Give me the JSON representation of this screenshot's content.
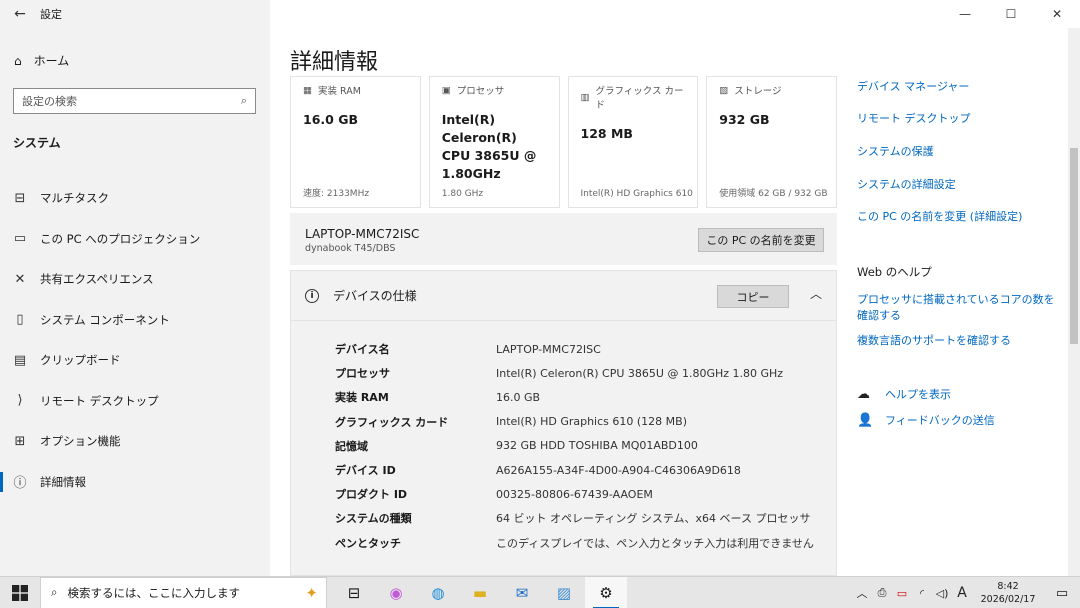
{
  "window": {
    "title": "設定",
    "controls": {
      "minimize": "—",
      "maximize": "☐",
      "close": "✕"
    }
  },
  "sidebar": {
    "home_label": "ホーム",
    "search_placeholder": "設定の検索",
    "section_title": "システム",
    "items": [
      {
        "label": "マルチタスク",
        "icon": "multitask-icon"
      },
      {
        "label": "この PC へのプロジェクション",
        "icon": "projection-icon"
      },
      {
        "label": "共有エクスペリエンス",
        "icon": "shared-experience-icon"
      },
      {
        "label": "システム コンポーネント",
        "icon": "system-components-icon"
      },
      {
        "label": "クリップボード",
        "icon": "clipboard-icon"
      },
      {
        "label": "リモート デスクトップ",
        "icon": "remote-desktop-icon"
      },
      {
        "label": "オプション機能",
        "icon": "optional-features-icon"
      },
      {
        "label": "詳細情報",
        "icon": "about-icon",
        "active": true
      }
    ]
  },
  "main": {
    "page_title": "詳細情報",
    "cards": [
      {
        "label": "実装 RAM",
        "value": "16.0 GB",
        "footer": "速度: 2133MHz",
        "icon": "ram-icon"
      },
      {
        "label": "プロセッサ",
        "value": "Intel(R) Celeron(R) CPU 3865U @ 1.80GHz",
        "footer": "1.80 GHz",
        "icon": "processor-icon"
      },
      {
        "label": "グラフィックス カード",
        "value": "128 MB",
        "footer": "Intel(R) HD Graphics 610",
        "icon": "graphics-icon"
      },
      {
        "label": "ストレージ",
        "value": "932 GB",
        "footer": "使用領域 62 GB / 932 GB",
        "icon": "storage-icon"
      }
    ],
    "device": {
      "name": "LAPTOP-MMC72ISC",
      "model": "dynabook T45/DBS",
      "rename_button": "この PC の名前を変更"
    },
    "specs": {
      "title": "デバイスの仕様",
      "copy_button": "コピー",
      "rows": [
        {
          "key": "デバイス名",
          "value": "LAPTOP-MMC72ISC"
        },
        {
          "key": "プロセッサ",
          "value": "Intel(R) Celeron(R) CPU 3865U @ 1.80GHz   1.80 GHz"
        },
        {
          "key": "実装 RAM",
          "value": "16.0 GB"
        },
        {
          "key": "グラフィックス カード",
          "value": "Intel(R) HD Graphics 610 (128 MB)"
        },
        {
          "key": "記憶域",
          "value": "932 GB HDD TOSHIBA MQ01ABD100"
        },
        {
          "key": "デバイス ID",
          "value": "A626A155-A34F-4D00-A904-C46306A9D618"
        },
        {
          "key": "プロダクト ID",
          "value": "00325-80806-67439-AAOEM"
        },
        {
          "key": "システムの種類",
          "value": "64 ビット オペレーティング システム、x64 ベース プロセッサ"
        },
        {
          "key": "ペンとタッチ",
          "value": "このディスプレイでは、ペン入力とタッチ入力は利用できません"
        }
      ]
    }
  },
  "related": {
    "links": [
      "デバイス マネージャー",
      "リモート デスクトップ",
      "システムの保護",
      "システムの詳細設定",
      "この PC の名前を変更 (詳細設定)"
    ],
    "web_help_title": "Web のヘルプ",
    "web_help_links": [
      "プロセッサに搭載されているコアの数を確認する",
      "複数言語のサポートを確認する"
    ],
    "help_label": "ヘルプを表示",
    "feedback_label": "フィードバックの送信"
  },
  "taskbar": {
    "search_placeholder": "検索するには、ここに入力します",
    "apps": [
      "task-view-icon",
      "copilot-icon",
      "edge-icon",
      "file-explorer-icon",
      "outlook-icon",
      "photos-icon",
      "settings-icon"
    ],
    "ime": "A",
    "time": "8:42",
    "date": "2026/02/17"
  }
}
